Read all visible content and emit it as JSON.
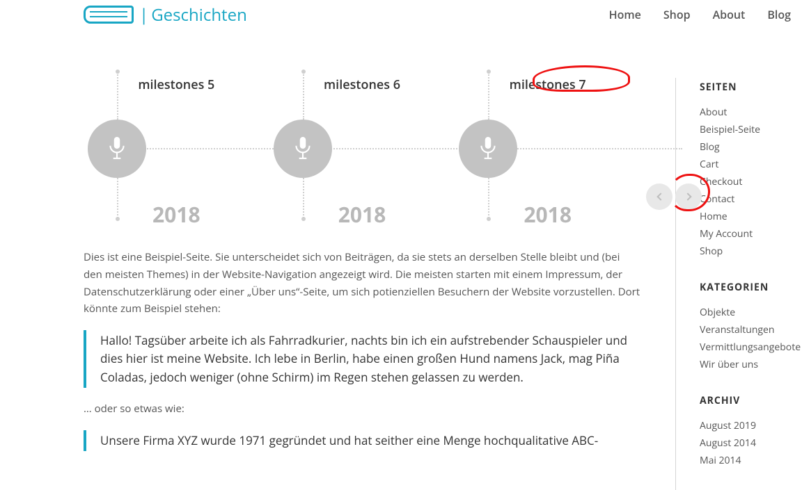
{
  "brand": {
    "name": "Geschichten"
  },
  "nav": {
    "items": [
      "Home",
      "Shop",
      "About",
      "Blog"
    ]
  },
  "timeline": {
    "milestones": [
      {
        "title": "milestones 5",
        "year": "2018"
      },
      {
        "title": "milestones 6",
        "year": "2018"
      },
      {
        "title": "milestones 7",
        "year": "2018"
      }
    ]
  },
  "content": {
    "intro": "Dies ist eine Beispiel-Seite. Sie unterscheidet sich von Beiträgen, da sie stets an derselben Stelle bleibt und (bei den meisten Themes) in der Website-Navigation angezeigt wird. Die meisten starten mit einem Impressum, der Datenschutzerklärung oder einer „Über uns“-Seite, um sich potienziellen Besuchern der Website vorzustellen. Dort könnte zum Beispiel stehen:",
    "quote1": "Hallo! Tagsüber arbeite ich als Fahrradkurier, nachts bin ich ein aufstrebender Schauspieler und dies hier ist meine Website. Ich lebe in Berlin, habe einen großen Hund namens Jack, mag Piña Coladas, jedoch weniger (ohne Schirm) im Regen stehen gelassen zu werden.",
    "bridge": "… oder so etwas wie:",
    "quote2": "Unsere Firma XYZ wurde 1971 gegründet und hat seither eine Menge hochqualitative ABC-"
  },
  "sidebar": {
    "seiten": {
      "heading": "SEITEN",
      "items": [
        "About",
        "Beispiel-Seite",
        "Blog",
        "Cart",
        "Checkout",
        "Contact",
        "Home",
        "My Account",
        "Shop"
      ]
    },
    "kategorien": {
      "heading": "KATEGORIEN",
      "items": [
        "Objekte",
        "Veranstaltungen",
        "Vermittlungsangebote",
        "Wir über uns"
      ]
    },
    "archiv": {
      "heading": "ARCHIV",
      "items": [
        "August 2019",
        "August 2014",
        "Mai 2014"
      ]
    }
  }
}
